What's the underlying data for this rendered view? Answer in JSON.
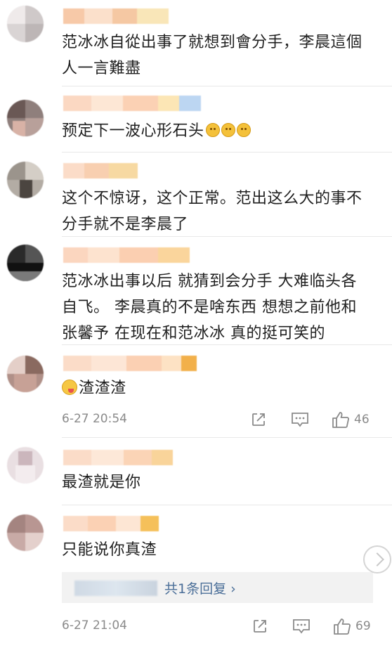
{
  "comments": [
    {
      "text_lines": [
        "范冰冰自從出事了就想到會分手，李晨這個",
        "人一言難盡"
      ]
    },
    {
      "text": "预定下一波心形石头"
    },
    {
      "text_lines": [
        "这个不惊讶，这个正常。范出这么大的事不",
        "分手就不是李晨了"
      ]
    },
    {
      "text_lines": [
        "范冰冰出事以后 就猜到会分手 大难临头各",
        "自飞。 李晨真的不是啥东西 想想之前他和",
        "张馨予 在现在和范冰冰 真的挺可笑的"
      ]
    },
    {
      "text": "渣渣渣",
      "time": "6-27 20:54",
      "likes": "46"
    },
    {
      "text": "最渣就是你"
    },
    {
      "text": "只能说你真渣",
      "reply_link": "共1条回复 ›",
      "time": "6-27 21:04",
      "likes": "69"
    }
  ],
  "icons": {
    "emoji_sequence": [
      "cat-face-icon",
      "cat-face-icon",
      "cat-face-icon"
    ],
    "leading_emoji": "tongue-face-icon",
    "actions": [
      "repost-icon",
      "comment-icon",
      "like-icon"
    ],
    "scroll_button": "chevron-up-icon"
  },
  "colors": {
    "link": "#4a6e98",
    "meta": "#8a8a8a",
    "reply_bg": "#f2f2f2"
  }
}
